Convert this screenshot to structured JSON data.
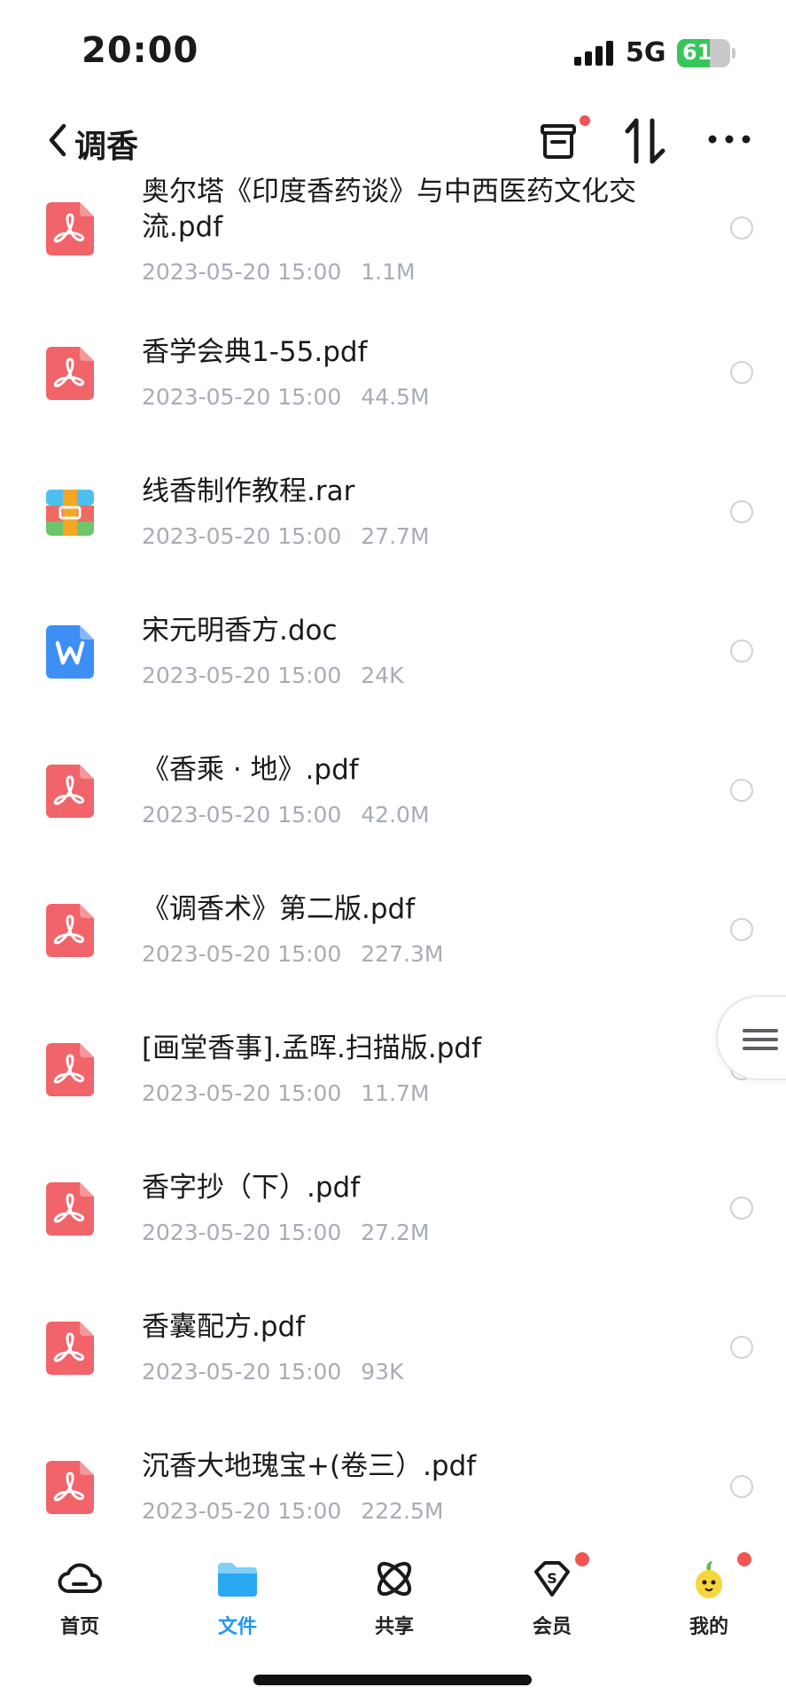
{
  "status_bar": {
    "time": "20:00",
    "network": "5G",
    "battery_percent": 61,
    "battery_text": "61"
  },
  "header": {
    "title": "调香",
    "icons": [
      "back-icon",
      "archive-icon",
      "sort-icon",
      "more-icon"
    ]
  },
  "files": [
    {
      "name": "奥尔塔《印度香药谈》与中西医药文化交流.pdf",
      "date": "2023-05-20 15:00",
      "size": "1.1M",
      "type": "pdf"
    },
    {
      "name": "香学会典1-55.pdf",
      "date": "2023-05-20 15:00",
      "size": "44.5M",
      "type": "pdf"
    },
    {
      "name": "线香制作教程.rar",
      "date": "2023-05-20 15:00",
      "size": "27.7M",
      "type": "rar"
    },
    {
      "name": "宋元明香方.doc",
      "date": "2023-05-20 15:00",
      "size": "24K",
      "type": "doc"
    },
    {
      "name": "《香乘 · 地》.pdf",
      "date": "2023-05-20 15:00",
      "size": "42.0M",
      "type": "pdf"
    },
    {
      "name": "《调香术》第二版.pdf",
      "date": "2023-05-20 15:00",
      "size": "227.3M",
      "type": "pdf"
    },
    {
      "name": "[画堂香事].孟晖.扫描版.pdf",
      "date": "2023-05-20 15:00",
      "size": "11.7M",
      "type": "pdf"
    },
    {
      "name": "香字抄（下）.pdf",
      "date": "2023-05-20 15:00",
      "size": "27.2M",
      "type": "pdf"
    },
    {
      "name": "香囊配方.pdf",
      "date": "2023-05-20 15:00",
      "size": "93K",
      "type": "pdf"
    },
    {
      "name": "沉香大地瑰宝+(卷三）.pdf",
      "date": "2023-05-20 15:00",
      "size": "222.5M",
      "type": "pdf"
    }
  ],
  "bottom_nav": [
    {
      "label": "首页",
      "icon": "cloud-icon",
      "active": false,
      "badge": false
    },
    {
      "label": "文件",
      "icon": "folder-icon",
      "active": true,
      "badge": false
    },
    {
      "label": "共享",
      "icon": "share-orbit-icon",
      "active": false,
      "badge": false
    },
    {
      "label": "会员",
      "icon": "vip-diamond-icon",
      "active": false,
      "badge": true
    },
    {
      "label": "我的",
      "icon": "avatar-icon",
      "active": false,
      "badge": true
    }
  ],
  "colors": {
    "accent": "#2196f3",
    "badge": "#f25353",
    "pdf": "#f0646a",
    "doc": "#3d8ef5",
    "meta_text": "#a7acb5",
    "battery": "#35c759"
  }
}
